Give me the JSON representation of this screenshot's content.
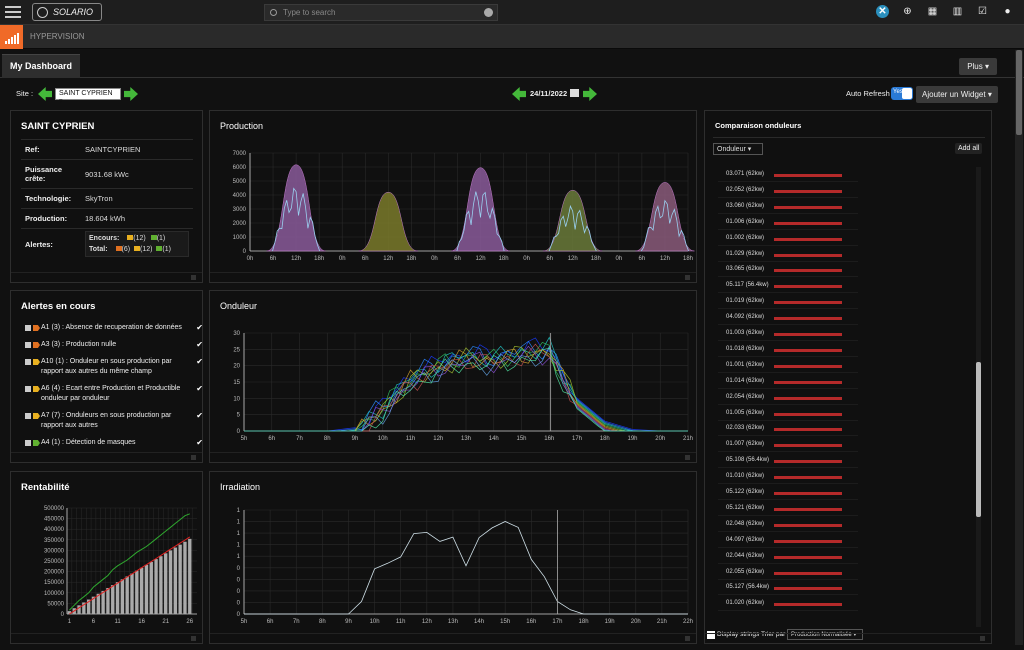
{
  "topbar": {
    "app_logo_text": "SOLARIO",
    "search_placeholder": "Type to search"
  },
  "section": {
    "title": "HYPERVISION"
  },
  "tabs": {
    "active": "My Dashboard",
    "plus_label": "Plus ▾"
  },
  "controls": {
    "site_label": "Site :",
    "site_value": "SAINT CYPRIEN",
    "date": "24/11/2022",
    "auto_refresh_label": "Auto Refresh",
    "toggle_label": "Yes",
    "add_widget_label": "Ajouter un Widget ▾"
  },
  "site_info": {
    "title": "SAINT CYPRIEN",
    "rows": [
      {
        "k": "Ref:",
        "v": "SAINTCYPRIEN"
      },
      {
        "k": "Puissance crête:",
        "v": "9031.68 kWc"
      },
      {
        "k": "Technologie:",
        "v": "SkyTron"
      },
      {
        "k": "Production:",
        "v": "18.604 kWh"
      }
    ],
    "alertes_label": "Alertes:",
    "encours_label": "Encours:",
    "encours_values": [
      "(12)",
      "(1)"
    ],
    "total_label": "Total:",
    "total_values": [
      "(6)",
      "(12)",
      "(1)"
    ]
  },
  "alerts": {
    "title": "Alertes en cours",
    "items": [
      {
        "text": "A1 (3) : Absence de recuperation de données",
        "color": "#e07020"
      },
      {
        "text": "A3 (3) : Production nulle",
        "color": "#e07020"
      },
      {
        "text": "A10 (1) : Onduleur en sous production par rapport aux autres du même champ",
        "color": "#e8b020"
      },
      {
        "text": "A6 (4) : Ecart entre Production et Productible onduleur par onduleur",
        "color": "#e8b020"
      },
      {
        "text": "A7 (7) : Onduleurs en sous production par rapport aux autres",
        "color": "#e8b020"
      },
      {
        "text": "A4 (1) : Détection de masques",
        "color": "#60b030"
      }
    ]
  },
  "production": {
    "title": "Production",
    "y_ticks": [
      "7000",
      "6000",
      "5000",
      "4000",
      "3000",
      "2000",
      "1000",
      "0"
    ],
    "x_ticks": [
      "0h",
      "6h",
      "12h",
      "18h",
      "0h",
      "6h",
      "12h",
      "18h",
      "0h",
      "6h",
      "12h",
      "18h",
      "0h",
      "6h",
      "12h",
      "18h",
      "0h",
      "6h",
      "12h",
      "18h"
    ]
  },
  "onduleur": {
    "title": "Onduleur",
    "y_ticks": [
      "30",
      "25",
      "20",
      "15",
      "10",
      "5",
      "0"
    ],
    "x_ticks": [
      "5h",
      "6h",
      "7h",
      "8h",
      "9h",
      "10h",
      "11h",
      "12h",
      "13h",
      "14h",
      "15h",
      "16h",
      "17h",
      "18h",
      "19h",
      "20h",
      "21h"
    ]
  },
  "rentabilite": {
    "title": "Rentabilité",
    "y_ticks": [
      "500000",
      "450000",
      "400000",
      "350000",
      "300000",
      "250000",
      "200000",
      "150000",
      "100000",
      "50000",
      "0"
    ],
    "x_ticks": [
      "1",
      "6",
      "11",
      "16",
      "21",
      "26"
    ]
  },
  "irradiation": {
    "title": "Irradiation",
    "y_ticks": [
      "1",
      "1",
      "1",
      "1",
      "1",
      "0",
      "0",
      "0",
      "0",
      "0"
    ],
    "x_ticks": [
      "5h",
      "6h",
      "7h",
      "8h",
      "9h",
      "10h",
      "11h",
      "12h",
      "13h",
      "14h",
      "15h",
      "16h",
      "17h",
      "18h",
      "19h",
      "20h",
      "21h",
      "22h"
    ]
  },
  "comparaison": {
    "title": "Comparaison onduleurs",
    "select_value": "Onduleur",
    "add_all_label": "Add all",
    "display_strings_label": "Display strings",
    "trier_label": "Trier par :",
    "trier_value": "Production Normalisée",
    "items": [
      "03.071 (62kw)",
      "02.052 (62kw)",
      "03.060 (62kw)",
      "01.006 (62kw)",
      "01.002 (62kw)",
      "01.029 (62kw)",
      "03.065 (62kw)",
      "05.117 (56.4kw)",
      "01.019 (62kw)",
      "04.092 (62kw)",
      "01.003 (62kw)",
      "01.018 (62kw)",
      "01.001 (62kw)",
      "01.014 (62kw)",
      "02.054 (62kw)",
      "01.005 (62kw)",
      "02.033 (62kw)",
      "01.007 (62kw)",
      "05.108 (56.4kw)",
      "01.010 (62kw)",
      "05.122 (62kw)",
      "05.121 (62kw)",
      "02.048 (62kw)",
      "04.097 (62kw)",
      "02.044 (62kw)",
      "02.055 (62kw)",
      "05.127 (56.4kw)",
      "01.020 (62kw)"
    ]
  },
  "chart_data": [
    {
      "type": "bar",
      "title": "Rentabilité",
      "categories": [
        "1",
        "2",
        "3",
        "4",
        "5",
        "6",
        "7",
        "8",
        "9",
        "10",
        "11",
        "12",
        "13",
        "14",
        "15",
        "16",
        "17",
        "18",
        "19",
        "20",
        "21",
        "22",
        "23",
        "24",
        "25",
        "26"
      ],
      "series": [
        {
          "values": [
            15000,
            30000,
            45000,
            60000,
            75000,
            90000,
            105000,
            120000,
            135000,
            150000,
            165000,
            180000,
            195000,
            210000,
            225000,
            240000,
            255000,
            270000,
            285000,
            300000,
            315000,
            330000,
            345000,
            360000,
            375000,
            390000
          ],
          "color": "#aaaaaa"
        }
      ],
      "lines": [
        {
          "values": [
            20000,
            45000,
            70000,
            90000,
            110000,
            140000,
            160000,
            180000,
            200000,
            230000,
            250000,
            265000,
            280000,
            300000,
            320000,
            335000,
            350000,
            370000,
            390000,
            410000,
            430000,
            450000,
            470000,
            490000,
            510000,
            520000
          ],
          "color": "#2fa82f"
        },
        {
          "values": [
            0,
            16000,
            32000,
            48000,
            64000,
            80000,
            96000,
            112000,
            128000,
            144000,
            160000,
            176000,
            192000,
            208000,
            224000,
            240000,
            256000,
            272000,
            288000,
            304000,
            320000,
            336000,
            352000,
            368000,
            384000,
            400000
          ],
          "color": "#e02020"
        }
      ],
      "ylim": [
        0,
        550000
      ]
    },
    {
      "type": "line",
      "title": "Irradiation",
      "x": [
        "9h",
        "9.5h",
        "10h",
        "10.5h",
        "11h",
        "11.5h",
        "12h",
        "12.5h",
        "13h",
        "13.5h",
        "14h",
        "14.5h",
        "15h",
        "15.5h",
        "16h",
        "16.5h",
        "17h",
        "17.5h",
        "18h"
      ],
      "values": [
        0.0,
        0.15,
        0.55,
        0.6,
        0.7,
        0.95,
        1.0,
        0.85,
        0.95,
        0.55,
        0.95,
        1.0,
        1.15,
        1.0,
        0.7,
        0.4,
        0.15,
        0.05,
        0.0
      ],
      "ylim": [
        0,
        1.25
      ]
    }
  ]
}
